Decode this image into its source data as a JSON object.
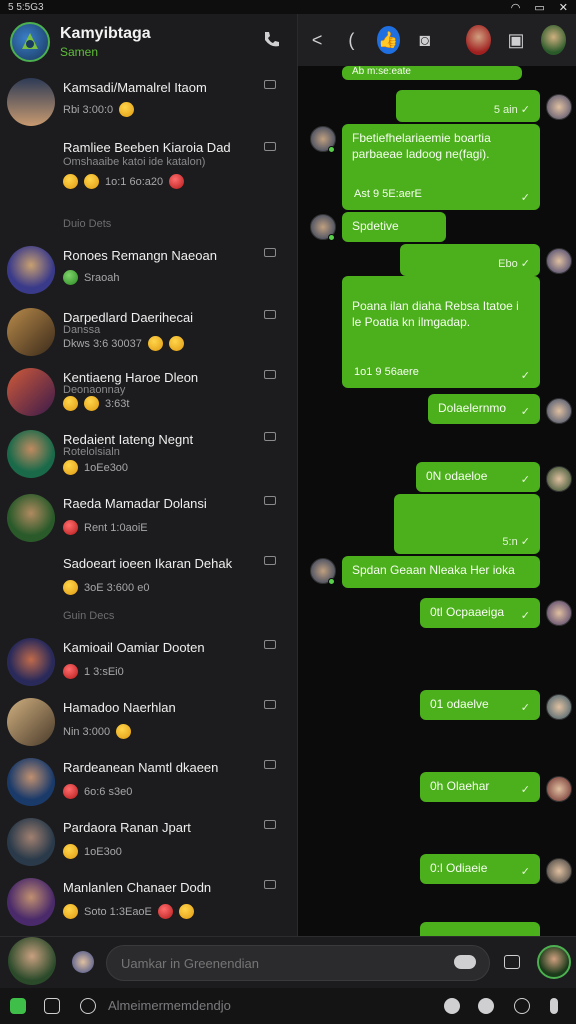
{
  "status_bar": {
    "left_text": "5 5:5G3"
  },
  "left_header": {
    "title": "Kamyibtaga",
    "subtitle": "Samen"
  },
  "chats": [
    {
      "name": "Kamsadi/Mamalrel Itaom",
      "preview": "Rbi 3:00:0",
      "avatar_color": "#c89a70",
      "emojis": [
        "yellow"
      ]
    },
    {
      "name": "Ramliee Beeben Kiaroia Dad",
      "sub": "Omshaaibe katoi ide katalon)",
      "preview": "1o:1 6o:a20",
      "avatar_color": "#1c1c1e",
      "emojis": [
        "yellow",
        "yellow",
        "red"
      ]
    },
    {
      "name": "Ronoes Remangn Naeoan",
      "preview": "Sraoah",
      "avatar_color": "#4858a8",
      "emojis": [
        "green"
      ]
    },
    {
      "name": "Darpedlard Daerihecai",
      "sub": "Danssa",
      "preview": "Dkws 3:6 30037",
      "avatar_color": "#7a5a3a",
      "emojis": [
        "yellow",
        "yellow"
      ]
    },
    {
      "name": "Kentiaeng Haroe Dleon",
      "sub": "Deonaonnay",
      "preview": "3:63t",
      "avatar_color": "#8a3a5a",
      "emojis": [
        "yellow",
        "yellow"
      ]
    },
    {
      "name": "Redaient Iateng Negnt",
      "sub": "Rotelolsialn",
      "preview": "1oEe3o0",
      "avatar_color": "#2a8a6a",
      "emojis": [
        "yellow"
      ]
    },
    {
      "name": "Raeda Mamadar Dolansi",
      "preview": "Rent 1:0aoiE",
      "avatar_color": "#4a7a4a",
      "emojis": [
        "red"
      ]
    },
    {
      "name": "Sadoeart ioeen Ikaran Dehak",
      "preview": "3oE 3:600 e0",
      "avatar_color": "#2a2a2c",
      "emojis": [
        "yellow"
      ]
    },
    {
      "name": "Kamioail Oamiar Dooten",
      "preview": "1 3:sEi0",
      "avatar_color": "#8a4a3a",
      "emojis": [
        "red"
      ]
    },
    {
      "name": "Hamadoo Naerhlan",
      "preview": "Nin 3:000",
      "avatar_color": "#6a5a4a",
      "emojis": [
        "yellow"
      ]
    },
    {
      "name": "Rardeanean Namtl dkaeen",
      "preview": "6o:6 s3e0",
      "avatar_color": "#3a5a8a",
      "emojis": [
        "red"
      ]
    },
    {
      "name": "Pardaora Ranan Jpart",
      "preview": "1oE3o0",
      "avatar_color": "#3a4a6a",
      "emojis": [
        "yellow"
      ]
    },
    {
      "name": "Manlanlen Chanaer Dodn",
      "preview": "Soto 1:3EaoE",
      "avatar_color": "#6a4a8a",
      "emojis": [
        "yellow",
        "red",
        "yellow"
      ]
    }
  ],
  "sections": [
    "Duio Dets",
    "Guin Decs"
  ],
  "right_header": {
    "back": "<",
    "paren": "("
  },
  "messages": [
    {
      "text": "Ab m:se:eate",
      "meta": "",
      "side": "right"
    },
    {
      "text": "",
      "meta": "5 ain ✓",
      "side": "right"
    },
    {
      "text": "Fbetiefhelariaemie boartia parbaeae ladoog ne(fagi).",
      "meta": "✓",
      "time": "Ast 9 5E:aerE",
      "side": "left"
    },
    {
      "text": "Spdetive",
      "meta": "",
      "side": "left"
    },
    {
      "text": "",
      "meta": "Ebo ✓",
      "side": "right"
    },
    {
      "text": "Poana ilan diaha Rebsa Itatoe i le Poatia kn ilmgadap.",
      "meta": "✓",
      "time": "1o1 9 56aere",
      "side": "right"
    },
    {
      "text": "Dolaelernmo",
      "meta": "✓",
      "side": "right"
    },
    {
      "text": "0N odaeloe",
      "meta": "✓",
      "side": "right"
    },
    {
      "text": "",
      "meta": "5:n ✓",
      "side": "right"
    },
    {
      "text": "Spdan Geaan Nleaka Her ioka",
      "meta": "",
      "side": "left"
    },
    {
      "text": "0tl Ocpaaeiga",
      "meta": "✓",
      "side": "right"
    },
    {
      "text": "01 odaelve",
      "meta": "✓",
      "side": "right"
    },
    {
      "text": "0h Olaehar",
      "meta": "✓",
      "side": "right"
    },
    {
      "text": "0:l Odiaeie",
      "meta": "✓",
      "side": "right"
    }
  ],
  "composer": {
    "placeholder": "Uamkar in Greenendian"
  },
  "bottombar": {
    "placeholder": "Almeimermemdendjo"
  },
  "colors": {
    "accent": "#4caf1c",
    "panel": "#1c1c1e",
    "bg": "#0b0b0c"
  }
}
